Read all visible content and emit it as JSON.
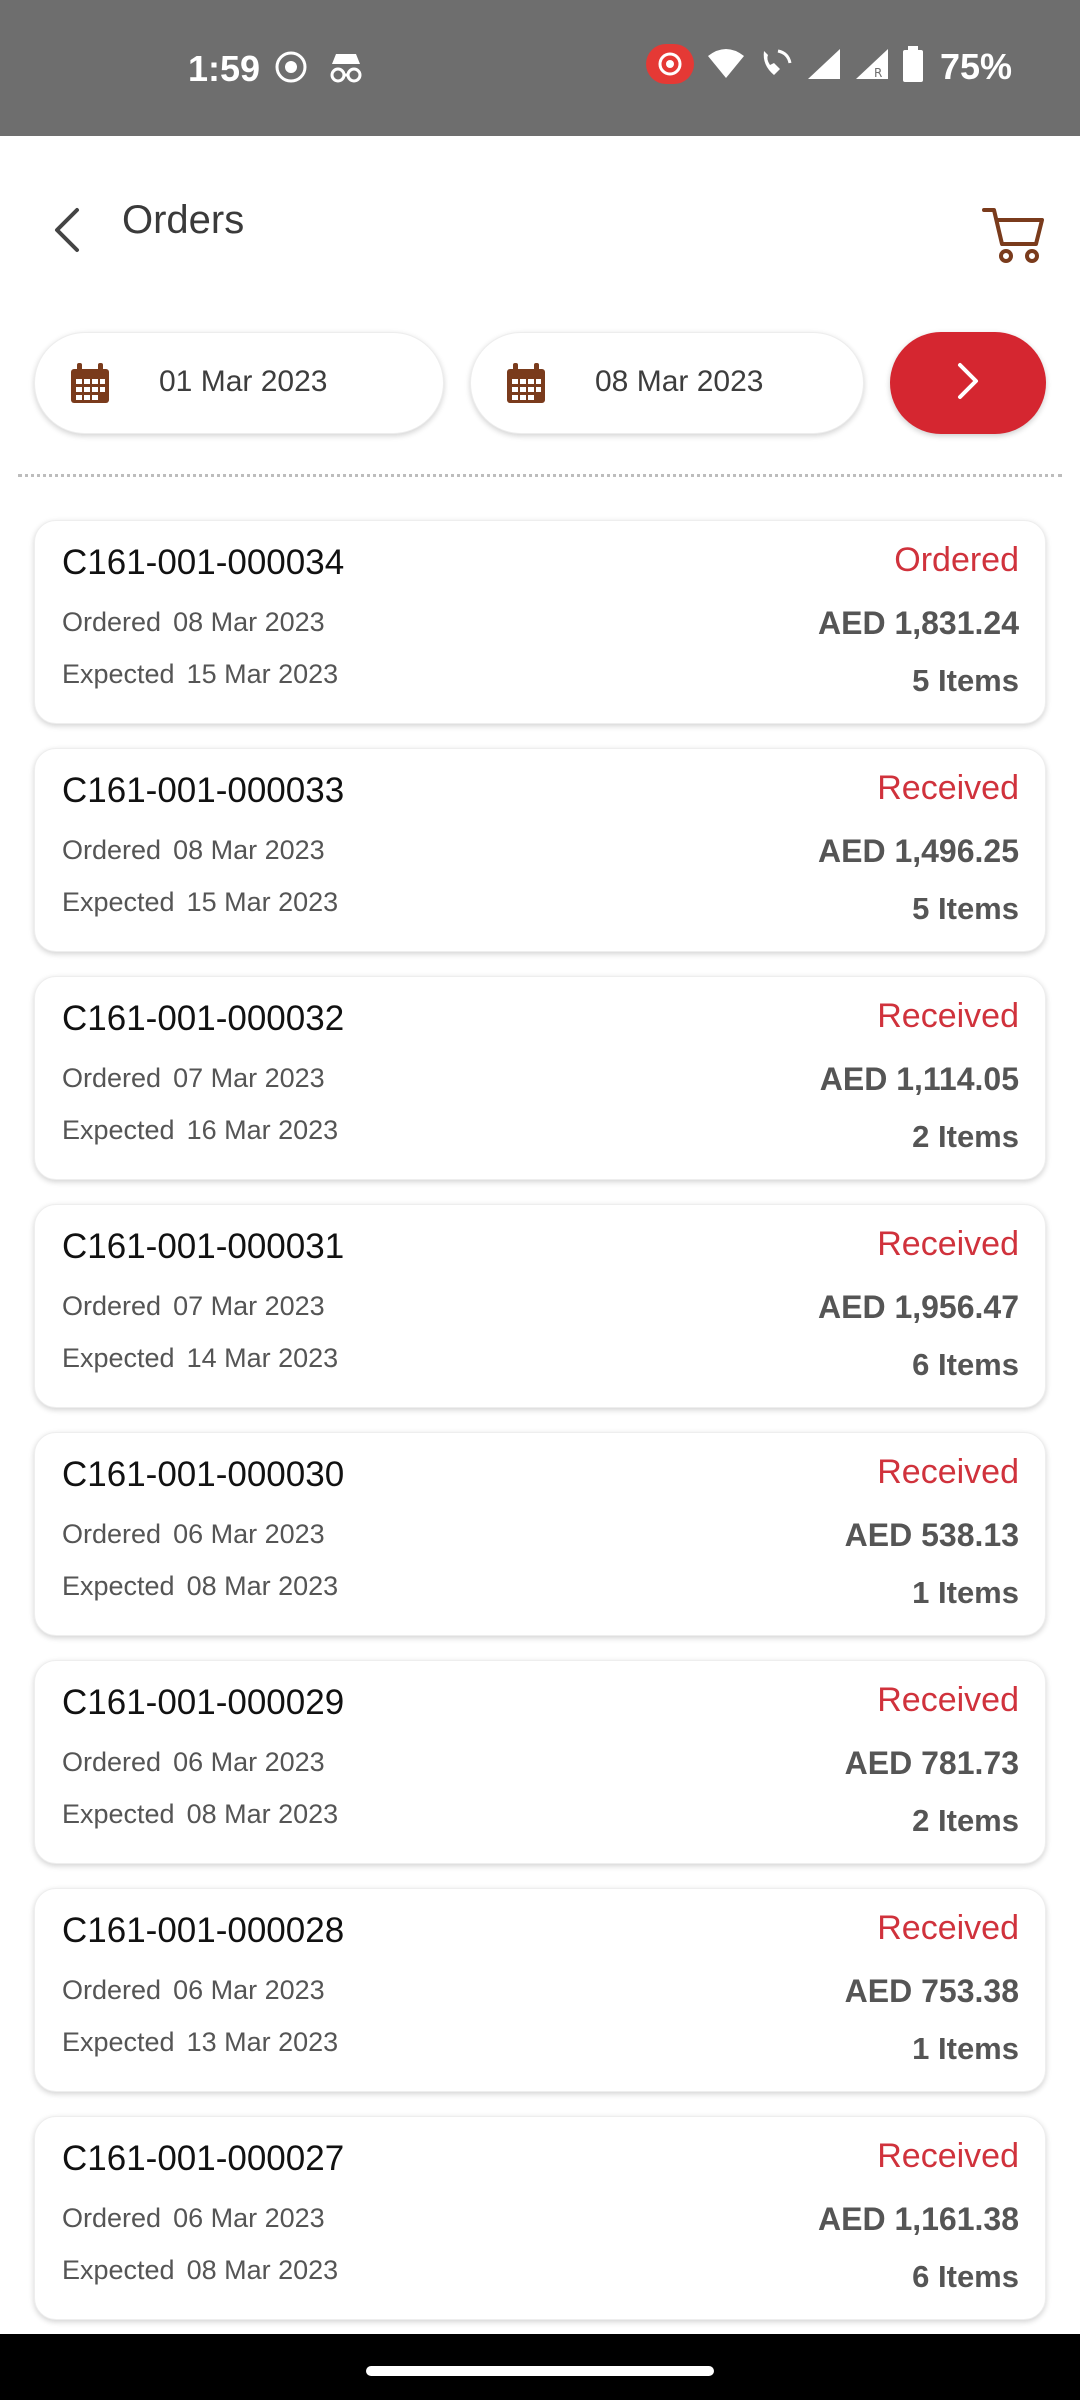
{
  "status_bar": {
    "time": "1:59",
    "battery": "75%",
    "left_icons": [
      "screen-record-icon",
      "incognito-icon"
    ],
    "right_icons": [
      "record-indicator-icon",
      "wifi-icon",
      "wifi-calling-icon",
      "signal-icon",
      "signal-roaming-icon",
      "battery-icon"
    ]
  },
  "header": {
    "title": "Orders",
    "back_icon": "chevron-left-icon",
    "cart_icon": "cart-icon"
  },
  "filters": {
    "from_date": "01 Mar 2023",
    "to_date": "08 Mar 2023",
    "calendar_icon": "calendar-icon",
    "go_icon": "chevron-right-icon"
  },
  "labels": {
    "ordered": "Ordered",
    "expected": "Expected"
  },
  "orders": [
    {
      "id": "C161-001-000034",
      "status": "Ordered",
      "ordered": "08 Mar 2023",
      "expected": "15 Mar 2023",
      "amount": "AED 1,831.24",
      "items": "5 Items"
    },
    {
      "id": "C161-001-000033",
      "status": "Received",
      "ordered": "08 Mar 2023",
      "expected": "15 Mar 2023",
      "amount": "AED 1,496.25",
      "items": "5 Items"
    },
    {
      "id": "C161-001-000032",
      "status": "Received",
      "ordered": "07 Mar 2023",
      "expected": "16 Mar 2023",
      "amount": "AED 1,114.05",
      "items": "2 Items"
    },
    {
      "id": "C161-001-000031",
      "status": "Received",
      "ordered": "07 Mar 2023",
      "expected": "14 Mar 2023",
      "amount": "AED 1,956.47",
      "items": "6 Items"
    },
    {
      "id": "C161-001-000030",
      "status": "Received",
      "ordered": "06 Mar 2023",
      "expected": "08 Mar 2023",
      "amount": "AED 538.13",
      "items": "1 Items"
    },
    {
      "id": "C161-001-000029",
      "status": "Received",
      "ordered": "06 Mar 2023",
      "expected": "08 Mar 2023",
      "amount": "AED 781.73",
      "items": "2 Items"
    },
    {
      "id": "C161-001-000028",
      "status": "Received",
      "ordered": "06 Mar 2023",
      "expected": "13 Mar 2023",
      "amount": "AED 753.38",
      "items": "1 Items"
    },
    {
      "id": "C161-001-000027",
      "status": "Received",
      "ordered": "06 Mar 2023",
      "expected": "08 Mar 2023",
      "amount": "AED 1,161.38",
      "items": "6 Items"
    }
  ],
  "colors": {
    "accent": "#d52630",
    "status_text": "#d0323c",
    "icon_brown": "#7a3b1c",
    "status_bar_bg": "#6e6e6e"
  }
}
